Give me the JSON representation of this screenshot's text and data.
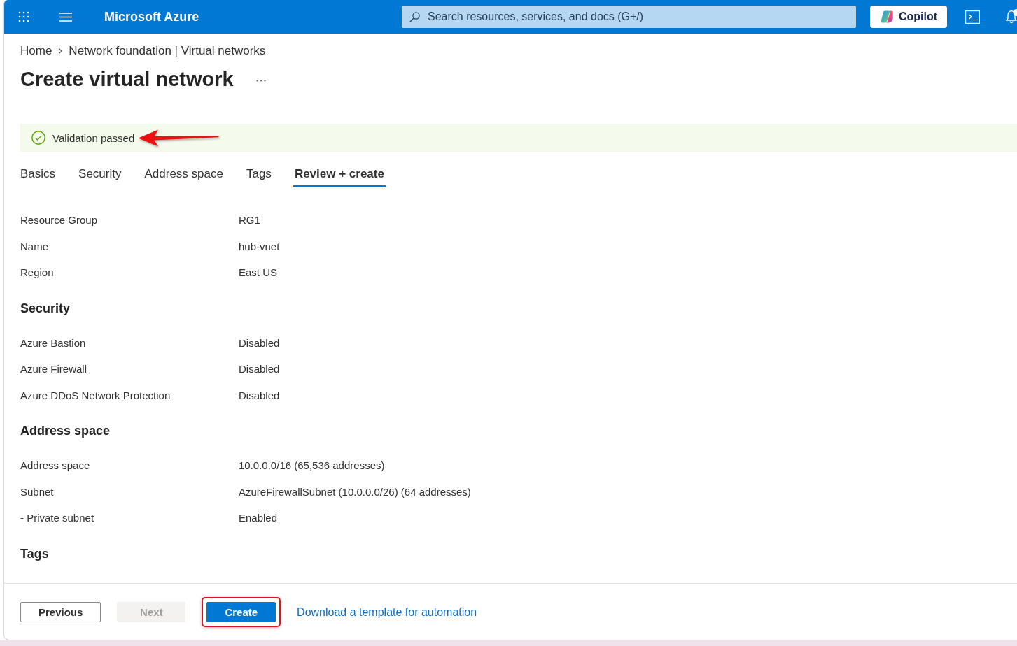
{
  "topbar": {
    "brand": "Microsoft Azure",
    "search": {
      "placeholder": "Search resources, services, and docs (G+/)"
    },
    "copilot": "Copilot"
  },
  "breadcrumb": [
    "Home",
    "Network foundation | Virtual networks"
  ],
  "title": "Create virtual network",
  "validation": {
    "text": "Validation passed",
    "passed": true
  },
  "tabs": [
    {
      "label": "Basics",
      "selected": false
    },
    {
      "label": "Security",
      "selected": false
    },
    {
      "label": "Address space",
      "selected": false
    },
    {
      "label": "Tags",
      "selected": false
    },
    {
      "label": "Review + create",
      "selected": true
    }
  ],
  "sections": [
    {
      "rows": [
        {
          "label": "Resource Group",
          "value": "RG1"
        },
        {
          "label": "Name",
          "value": "hub-vnet"
        },
        {
          "label": "Region",
          "value": "East US"
        }
      ]
    },
    {
      "heading": "Security",
      "rows": [
        {
          "label": "Azure Bastion",
          "value": "Disabled"
        },
        {
          "label": "Azure Firewall",
          "value": "Disabled"
        },
        {
          "label": "Azure DDoS Network Protection",
          "value": "Disabled"
        }
      ]
    },
    {
      "heading": "Address space",
      "rows": [
        {
          "label": "Address space",
          "value": "10.0.0.0/16 (65,536 addresses)"
        },
        {
          "label": "Subnet",
          "value": "AzureFirewallSubnet (10.0.0.0/26) (64 addresses)"
        },
        {
          "label": "- Private subnet",
          "value": "Enabled"
        }
      ]
    },
    {
      "heading": "Tags"
    }
  ],
  "footer": {
    "buttons": [
      {
        "label": "Previous",
        "kind": "secondary",
        "disabled": false,
        "highlighted": false
      },
      {
        "label": "Next",
        "kind": "secondary",
        "disabled": true,
        "highlighted": false
      },
      {
        "label": "Create",
        "kind": "primary",
        "disabled": false,
        "highlighted": true
      }
    ],
    "link": "Download a template for automation"
  }
}
